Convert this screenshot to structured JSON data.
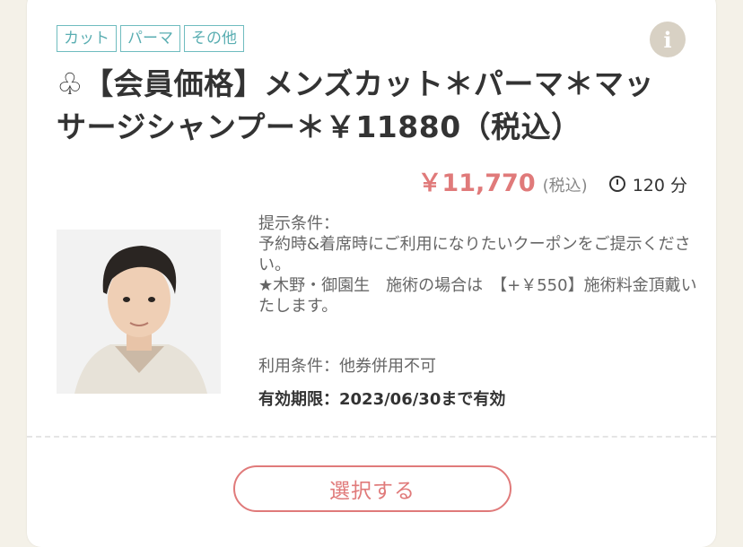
{
  "tags": [
    "カット",
    "パーマ",
    "その他"
  ],
  "info_icon": {
    "glyph": "i",
    "name": "info-icon"
  },
  "title": "♧【会員価格】メンズカット＊パーマ＊マッサージシャンプー＊￥11880（税込）",
  "price": {
    "amount": "￥11,770",
    "tax_label": "(税込)",
    "duration": "120 分"
  },
  "conditions": {
    "heading": "提示条件：",
    "line1": "予約時&着席時にご利用になりたいクーポンをご提示ください。",
    "line2": "★木野・御園生　施術の場合は　【+￥550】施術料金頂戴いたします。"
  },
  "usage": "利用条件：他券併用不可",
  "validity": "有効期限：2023/06/30まで有効",
  "button": {
    "label": "選択する"
  },
  "colors": {
    "accent": "#e07a7a",
    "tag": "#6fbcbf",
    "background": "#f4f1e8"
  }
}
